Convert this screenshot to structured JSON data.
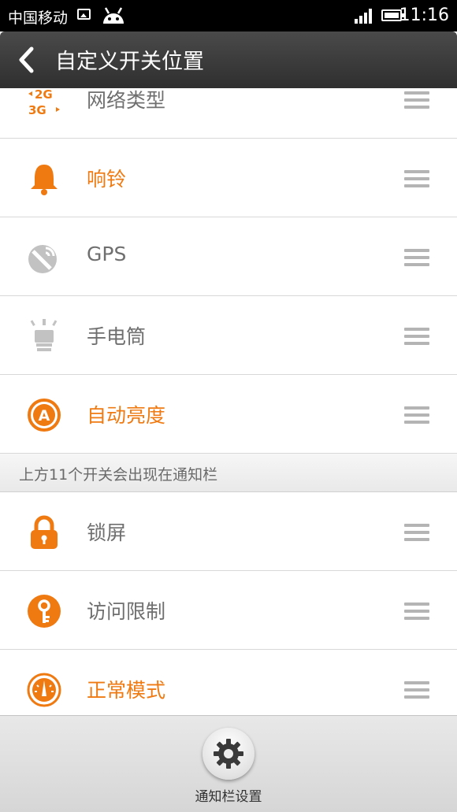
{
  "status_bar": {
    "carrier": "中国移动",
    "time": "11:16"
  },
  "header": {
    "title": "自定义开关位置"
  },
  "items_top": [
    {
      "label": "网络类型",
      "icon": "network-type-icon",
      "color": "gray"
    },
    {
      "label": "响铃",
      "icon": "bell-icon",
      "color": "orange"
    },
    {
      "label": "GPS",
      "icon": "gps-icon",
      "color": "gray"
    },
    {
      "label": "手电筒",
      "icon": "flashlight-icon",
      "color": "gray"
    },
    {
      "label": "自动亮度",
      "icon": "auto-brightness-icon",
      "color": "orange"
    }
  ],
  "network_icon_text": {
    "top": "2G",
    "bottom": "3G"
  },
  "auto_brightness_letter": "A",
  "section_label": "上方11个开关会出现在通知栏",
  "items_bottom": [
    {
      "label": "锁屏",
      "icon": "lock-icon",
      "color": "gray"
    },
    {
      "label": "访问限制",
      "icon": "key-icon",
      "color": "gray"
    },
    {
      "label": "正常模式",
      "icon": "speedometer-icon",
      "color": "orange"
    }
  ],
  "bottom_bar": {
    "label": "通知栏设置"
  },
  "colors": {
    "accent": "#f07a12",
    "text_gray": "#6f6f6f",
    "header_bg": "#3b3b3b"
  }
}
